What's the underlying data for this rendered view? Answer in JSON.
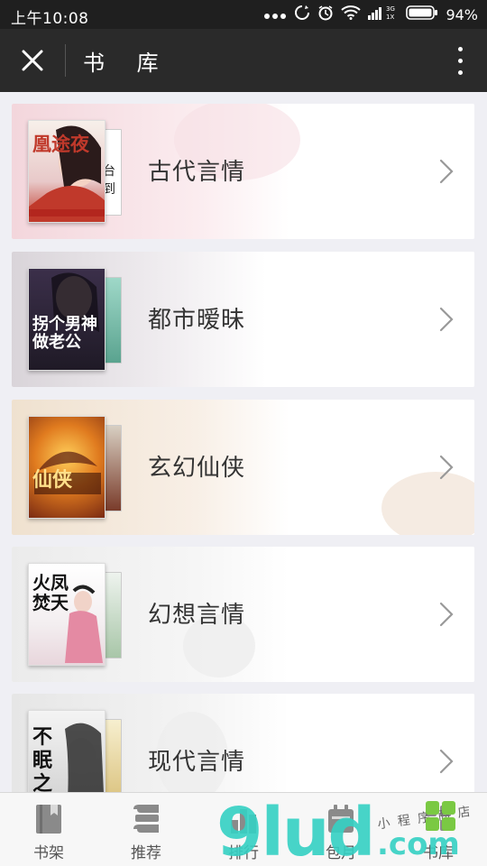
{
  "status_bar": {
    "time": "上午10:08",
    "battery_percent": "94%",
    "network_top": "3G",
    "network_bottom": "1X"
  },
  "header": {
    "title": "书  库",
    "close_icon": "close-icon",
    "more_icon": "more-vertical-icon"
  },
  "categories": [
    {
      "label": "古代言情",
      "cover_text": "凰途夜",
      "accent": "#c0392b"
    },
    {
      "label": "都市暧昧",
      "cover_text": "拐个男神做老公",
      "accent": "#2c2230"
    },
    {
      "label": "玄幻仙侠",
      "cover_text": "仙侠",
      "accent": "#b5651d"
    },
    {
      "label": "幻想言情",
      "cover_text": "火凤焚天",
      "accent": "#e48aa3"
    },
    {
      "label": "现代言情",
      "cover_text": "不眠之夜",
      "accent": "#555555"
    }
  ],
  "tabs": [
    {
      "label": "书架",
      "icon": "bookshelf-icon"
    },
    {
      "label": "推荐",
      "icon": "recommend-icon"
    },
    {
      "label": "排行",
      "icon": "ranking-icon"
    },
    {
      "label": "包月",
      "icon": "subscription-icon"
    },
    {
      "label": "书库",
      "icon": "library-icon"
    }
  ],
  "watermark": {
    "logo_text": "9lud",
    "domain_text": ".com",
    "note": "小 程 序 商 店"
  },
  "colors": {
    "status_bg": "#1f1f1f",
    "header_bg": "#2a2a2a",
    "page_bg": "#efeff4",
    "card_bg": "#ffffff",
    "label_color": "#333333",
    "watermark_teal": "#35d1c4"
  }
}
